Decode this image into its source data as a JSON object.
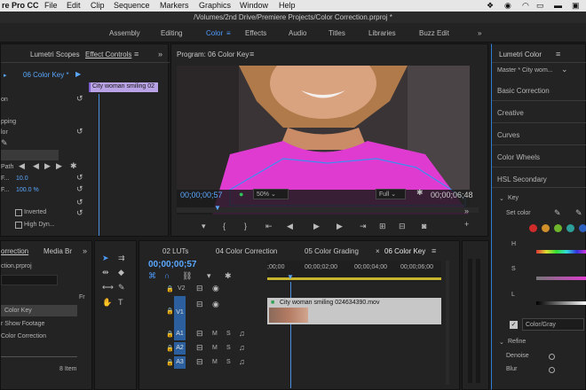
{
  "menubar": {
    "app": "re Pro CC",
    "items": [
      "File",
      "Edit",
      "Clip",
      "Sequence",
      "Markers",
      "Graphics",
      "Window",
      "Help"
    ]
  },
  "titlebar": {
    "path": "/Volumes/2nd Drive/Premiere Projects/Color Correction.prproj *"
  },
  "workspaces": {
    "items": [
      "Assembly",
      "Editing",
      "Color",
      "Effects",
      "Audio",
      "Titles",
      "Libraries",
      "Buzz Edit"
    ],
    "active": "Color"
  },
  "left_panel": {
    "tabs": [
      "Lumetri Scopes",
      "Effect Controls"
    ],
    "sequence_label": "06 Color Key *",
    "clip_label": "City woman smiling 02",
    "rows": [
      "on",
      "pping",
      "lor",
      "Path",
      "F...",
      "F...",
      "Inverted",
      "High Dyn..."
    ],
    "values": [
      "10.0",
      "100.0 %"
    ]
  },
  "program": {
    "title": "Program: 06 Color Key",
    "timecode": "00;00;00;57",
    "zoom": "50%",
    "quality": "Full",
    "duration": "00;00;06;48"
  },
  "lumetri": {
    "title": "Lumetri Color",
    "master": "Master * City wom...",
    "sections": [
      "Basic Correction",
      "Creative",
      "Curves",
      "Color Wheels",
      "HSL Secondary"
    ],
    "key_label": "Key",
    "set_color": "Set color",
    "hsl": [
      "H",
      "S",
      "L"
    ],
    "color_gray": "Color/Gray",
    "refine": "Refine",
    "denoise": "Denoise",
    "blur": "Blur"
  },
  "project": {
    "tabs": [
      "orrection",
      "Media Br"
    ],
    "file": "ction.prproj",
    "items": [
      "Color Key",
      "r Show Footage",
      "Color Correction"
    ],
    "count": "8 Item"
  },
  "timeline": {
    "tabs": [
      "02 LUTs",
      "04 Color Correction",
      "05 Color Grading",
      "06 Color Key"
    ],
    "timecode": "00;00;00;57",
    "ruler": [
      ";00;00",
      "00;00;02;00",
      "00;00;04;00",
      "00;00;06;00"
    ],
    "video_tracks": [
      "V2",
      "V1"
    ],
    "audio_tracks": [
      "A1",
      "A2",
      "A3"
    ],
    "clip": "City woman smiling 024634390.mov",
    "m": "M",
    "s": "S"
  },
  "colors": {
    "accent": "#2a7fd6",
    "clip": "#b9a2e6",
    "magenta": "#e03bd1"
  },
  "icons": [
    "dropbox-icon",
    "record-icon",
    "wifi-icon",
    "battery-icon",
    "flag-icon",
    "wrench-icon",
    "play-icon",
    "step-back-icon",
    "step-forward-icon",
    "camera-icon",
    "plus-icon",
    "eyedropper-icon",
    "selection-tool-icon",
    "track-select-icon",
    "ripple-icon",
    "razor-icon",
    "pen-icon",
    "hand-icon",
    "type-icon",
    "lock-icon",
    "eye-icon",
    "mic-icon"
  ]
}
